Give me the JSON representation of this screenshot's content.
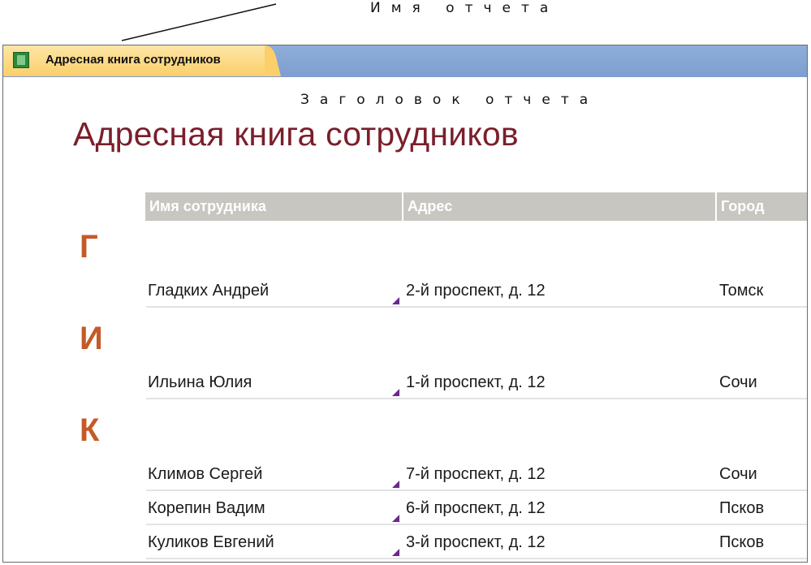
{
  "annotations": {
    "report_name": "Имя отчета",
    "report_header": "Заголовок отчета"
  },
  "tab": {
    "label": "Адресная книга сотрудников",
    "icon": "report-icon"
  },
  "report": {
    "title": "Адресная книга сотрудников",
    "columns": [
      "Имя сотрудника",
      "Адрес",
      "Город"
    ],
    "groups": [
      {
        "letter": "Г",
        "rows": [
          {
            "name": "Гладких Андрей",
            "address": "2-й проспект, д. 12",
            "city": "Томск"
          }
        ]
      },
      {
        "letter": "И",
        "rows": [
          {
            "name": "Ильина Юлия",
            "address": "1-й проспект, д. 12",
            "city": "Сочи"
          }
        ]
      },
      {
        "letter": "К",
        "rows": [
          {
            "name": "Климов Сергей",
            "address": "7-й проспект, д. 12",
            "city": "Сочи"
          },
          {
            "name": "Корепин Вадим",
            "address": "6-й проспект, д. 12",
            "city": "Псков"
          },
          {
            "name": "Куликов Евгений",
            "address": "3-й проспект, д. 12",
            "city": "Псков"
          }
        ]
      }
    ]
  },
  "colors": {
    "title": "#7a1f2b",
    "group_letter": "#c55a28",
    "header_bar": "#c8c6c0",
    "tab_active": "#fbcf6a",
    "tabstrip": "#7e9fd0"
  }
}
